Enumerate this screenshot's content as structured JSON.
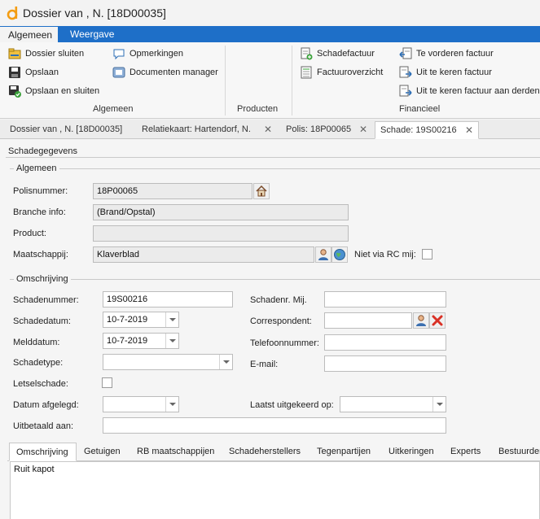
{
  "window": {
    "title": "Dossier van ,  N. [18D00035]"
  },
  "ribbon": {
    "tabs": [
      {
        "label": "Algemeen"
      },
      {
        "label": "Weergave"
      }
    ],
    "groups": {
      "algemeen": {
        "label": "Algemeen",
        "buttons": [
          {
            "label": "Dossier sluiten"
          },
          {
            "label": "Opslaan"
          },
          {
            "label": "Opslaan en sluiten"
          },
          {
            "label": "Opmerkingen"
          },
          {
            "label": "Documenten manager"
          }
        ]
      },
      "producten": {
        "label": "Producten"
      },
      "financieel": {
        "label": "Financieel",
        "buttons": [
          {
            "label": "Schadefactuur"
          },
          {
            "label": "Factuuroverzicht"
          },
          {
            "label": "Te vorderen factuur"
          },
          {
            "label": "Uit te keren factuur"
          },
          {
            "label": "Uit te keren factuur aan derden"
          }
        ]
      }
    }
  },
  "doc_tabs": [
    {
      "label": "Dossier van ,  N. [18D00035]"
    },
    {
      "label": "Relatiekaart: Hartendorf, N."
    },
    {
      "label": "Polis: 18P00065"
    },
    {
      "label": "Schade: 19S00216"
    }
  ],
  "panel": {
    "title": "Schadegegevens",
    "algemeen": {
      "title": "Algemeen",
      "polisnummer": {
        "label": "Polisnummer:",
        "value": "18P00065"
      },
      "branche": {
        "label": "Branche info:",
        "value": "(Brand/Opstal)"
      },
      "product": {
        "label": "Product:",
        "value": ""
      },
      "maatschappij": {
        "label": "Maatschappij:",
        "value": "Klaverblad"
      },
      "niet_via_rc": {
        "label": "Niet via RC mij:",
        "checked": false
      }
    },
    "omschrijving": {
      "title": "Omschrijving",
      "schadenummer": {
        "label": "Schadenummer:",
        "value": "19S00216"
      },
      "schadedatum": {
        "label": "Schadedatum:",
        "value": "10-7-2019"
      },
      "melddatum": {
        "label": "Melddatum:",
        "value": "10-7-2019"
      },
      "schadetype": {
        "label": "Schadetype:",
        "value": ""
      },
      "letselschade": {
        "label": "Letselschade:",
        "checked": false
      },
      "datum_afgelegd": {
        "label": "Datum afgelegd:",
        "value": ""
      },
      "uitbetaald_aan": {
        "label": "Uitbetaald aan:",
        "value": ""
      },
      "schadenr_mij": {
        "label": "Schadenr. Mij.",
        "value": ""
      },
      "correspondent": {
        "label": "Correspondent:",
        "value": ""
      },
      "telefoonnummer": {
        "label": "Telefoonnummer:",
        "value": ""
      },
      "email": {
        "label": "E-mail:",
        "value": ""
      },
      "laatst_uitgekeerd": {
        "label": "Laatst uitgekeerd op:",
        "value": ""
      }
    }
  },
  "bottom_tabs": [
    {
      "label": "Omschrijving"
    },
    {
      "label": "Getuigen"
    },
    {
      "label": "RB maatschappijen"
    },
    {
      "label": "Schadeherstellers"
    },
    {
      "label": "Tegenpartijen"
    },
    {
      "label": "Uitkeringen"
    },
    {
      "label": "Experts"
    },
    {
      "label": "Bestuurders"
    }
  ],
  "memo": {
    "value": "Ruit kapot"
  },
  "colors": {
    "accent": "#1e6fc8",
    "logo": "#f39c12",
    "delete": "#d93025"
  }
}
